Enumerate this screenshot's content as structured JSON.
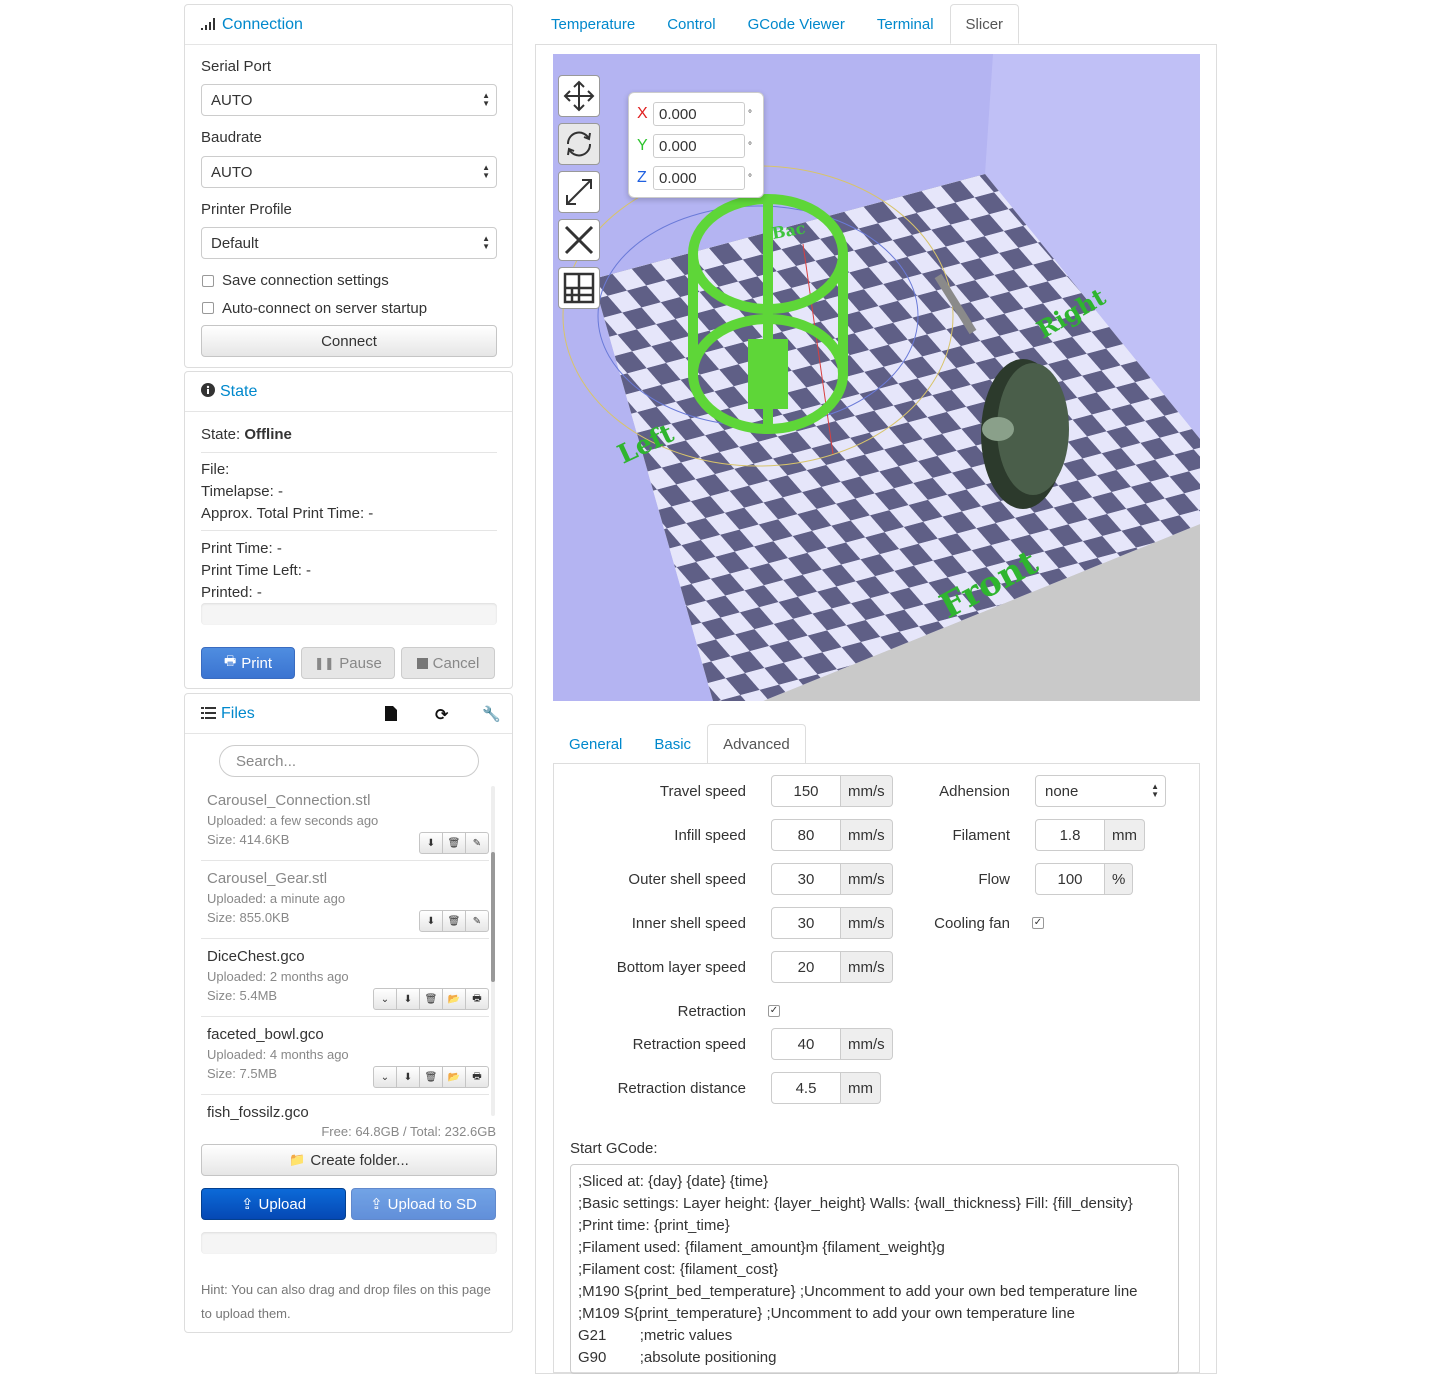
{
  "connection": {
    "title": "Connection",
    "serial_port_label": "Serial Port",
    "serial_port_value": "AUTO",
    "baudrate_label": "Baudrate",
    "baudrate_value": "AUTO",
    "printer_profile_label": "Printer Profile",
    "printer_profile_value": "Default",
    "save_settings_label": "Save connection settings",
    "autoconnect_label": "Auto-connect on server startup",
    "connect_button": "Connect"
  },
  "state": {
    "title": "State",
    "state_label": "State:",
    "state_value": "Offline",
    "file": "File:",
    "timelapse": "Timelapse: -",
    "approx_total": "Approx. Total Print Time: -",
    "print_time": "Print Time: -",
    "print_time_left": "Print Time Left: -",
    "printed": "Printed: -",
    "print_button": "Print",
    "pause_button": "Pause",
    "cancel_button": "Cancel"
  },
  "files": {
    "title": "Files",
    "search_placeholder": "Search...",
    "items": [
      {
        "name": "Carousel_Connection.stl",
        "uploaded": "Uploaded: a few seconds ago",
        "size": "Size: 414.6KB"
      },
      {
        "name": "Carousel_Gear.stl",
        "uploaded": "Uploaded: a minute ago",
        "size": "Size: 855.0KB"
      },
      {
        "name": "DiceChest.gco",
        "uploaded": "Uploaded: 2 months ago",
        "size": "Size: 5.4MB"
      },
      {
        "name": "faceted_bowl.gco",
        "uploaded": "Uploaded: 4 months ago",
        "size": "Size: 7.5MB"
      },
      {
        "name": "fish_fossilz.gco"
      }
    ],
    "free_total": "Free: 64.8GB / Total: 232.6GB",
    "create_folder": "Create folder...",
    "upload": "Upload",
    "upload_sd": "Upload to SD",
    "hint": "Hint: You can also drag and drop files on this page to upload them."
  },
  "main_tabs": [
    "Temperature",
    "Control",
    "GCode Viewer",
    "Terminal",
    "Slicer"
  ],
  "viewer": {
    "coords": {
      "x": "0.000",
      "y": "0.000",
      "z": "0.000"
    },
    "axis_labels": {
      "x": "X",
      "y": "Y",
      "z": "Z"
    },
    "deg": "°",
    "bed_labels": {
      "back": "Bac",
      "left": "Left",
      "right": "Right",
      "front": "Front"
    }
  },
  "settings_tabs": [
    "General",
    "Basic",
    "Advanced"
  ],
  "advanced": {
    "left": [
      {
        "label": "Travel speed",
        "value": "150",
        "unit": "mm/s"
      },
      {
        "label": "Infill speed",
        "value": "80",
        "unit": "mm/s"
      },
      {
        "label": "Outer shell speed",
        "value": "30",
        "unit": "mm/s"
      },
      {
        "label": "Inner shell speed",
        "value": "30",
        "unit": "mm/s"
      },
      {
        "label": "Bottom layer speed",
        "value": "20",
        "unit": "mm/s"
      },
      {
        "label": "Retraction"
      },
      {
        "label": "Retraction speed",
        "value": "40",
        "unit": "mm/s"
      },
      {
        "label": "Retraction distance",
        "value": "4.5",
        "unit": "mm"
      }
    ],
    "right": [
      {
        "label": "Adhension",
        "value": "none"
      },
      {
        "label": "Filament",
        "value": "1.8",
        "unit": "mm"
      },
      {
        "label": "Flow",
        "value": "100",
        "unit": "%"
      },
      {
        "label": "Cooling fan"
      }
    ],
    "start_gcode_label": "Start GCode:",
    "start_gcode": ";Sliced at: {day} {date} {time}\n;Basic settings: Layer height: {layer_height} Walls: {wall_thickness} Fill: {fill_density}\n;Print time: {print_time}\n;Filament used: {filament_amount}m {filament_weight}g\n;Filament cost: {filament_cost}\n;M190 S{print_bed_temperature} ;Uncomment to add your own bed temperature line\n;M109 S{print_temperature} ;Uncomment to add your own temperature line\nG21        ;metric values\nG90        ;absolute positioning"
  }
}
